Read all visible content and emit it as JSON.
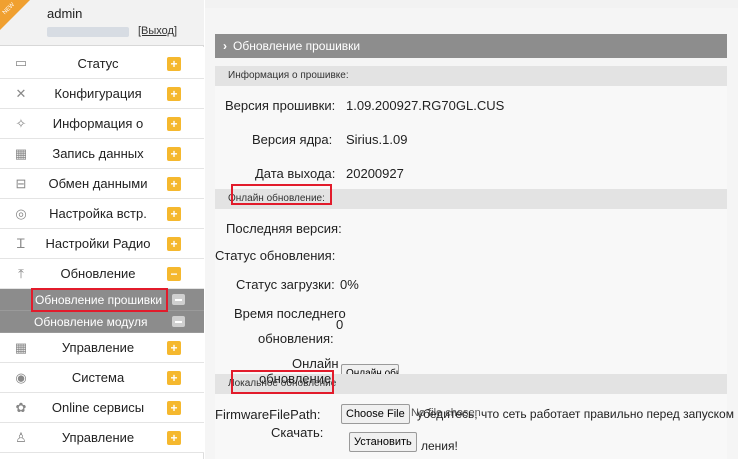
{
  "user": {
    "ribbon": "NEW",
    "name": "admin",
    "logout_label": "[Выход]"
  },
  "sidebar": {
    "items": [
      {
        "icon": "monitor-icon",
        "label": "Статус"
      },
      {
        "icon": "tools-icon",
        "label": "Конфигурация"
      },
      {
        "icon": "info-icon",
        "label": "Информация о"
      },
      {
        "icon": "calendar-icon",
        "label": "Запись данных"
      },
      {
        "icon": "network-icon",
        "label": "Обмен данными"
      },
      {
        "icon": "settings-icon",
        "label": "Настройка встр."
      },
      {
        "icon": "radio-icon",
        "label": "Настройки Радио"
      },
      {
        "icon": "upload-icon",
        "label": "Обновление"
      },
      {
        "icon": "calendar-icon",
        "label": "Управление"
      },
      {
        "icon": "system-icon",
        "label": "Система"
      },
      {
        "icon": "cloud-icon",
        "label": "Online сервисы"
      },
      {
        "icon": "users-icon",
        "label": "Управление"
      }
    ],
    "sub_items": [
      {
        "label": "Обновление прошивки"
      },
      {
        "label": "Обновление модуля"
      }
    ]
  },
  "main": {
    "header_title": "Обновление прошивки",
    "firmware_info": {
      "section_title": "Информация о прошивке:",
      "version_label": "Версия прошивки:",
      "version_value": "1.09.200927.RG70GL.CUS",
      "kernel_label": "Версия ядра:",
      "kernel_value": "Sirius.1.09",
      "date_label": "Дата выхода:",
      "date_value": "20200927"
    },
    "online_update": {
      "section_title": "Онлайн обновление:",
      "latest_label": "Последняя версия:",
      "status_label": "Статус обновления:",
      "download_label": "Статус загрузки:",
      "download_value": "0%",
      "last_update_label_1": "Время последнего",
      "last_update_label_2": "обновления:",
      "last_update_value": "0",
      "online_label_1": "Онлайн",
      "online_label_2": "обновление:",
      "online_button": "Онлайн обн"
    },
    "local_update": {
      "section_title": "Локальное обновление",
      "file_path_label": "FirmwareFilePath:",
      "choose_file": "Choose File",
      "no_file": "No file chosen",
      "note_text": "убедитесь, что сеть работает правильно перед запуском",
      "download_label": "Скачать:",
      "install_button": "Установить",
      "install_note": "ления!"
    }
  },
  "colors": {
    "accent_plus": "#f5b82e",
    "highlight": "#e21b2b",
    "header_bg": "#8d8d8d"
  }
}
